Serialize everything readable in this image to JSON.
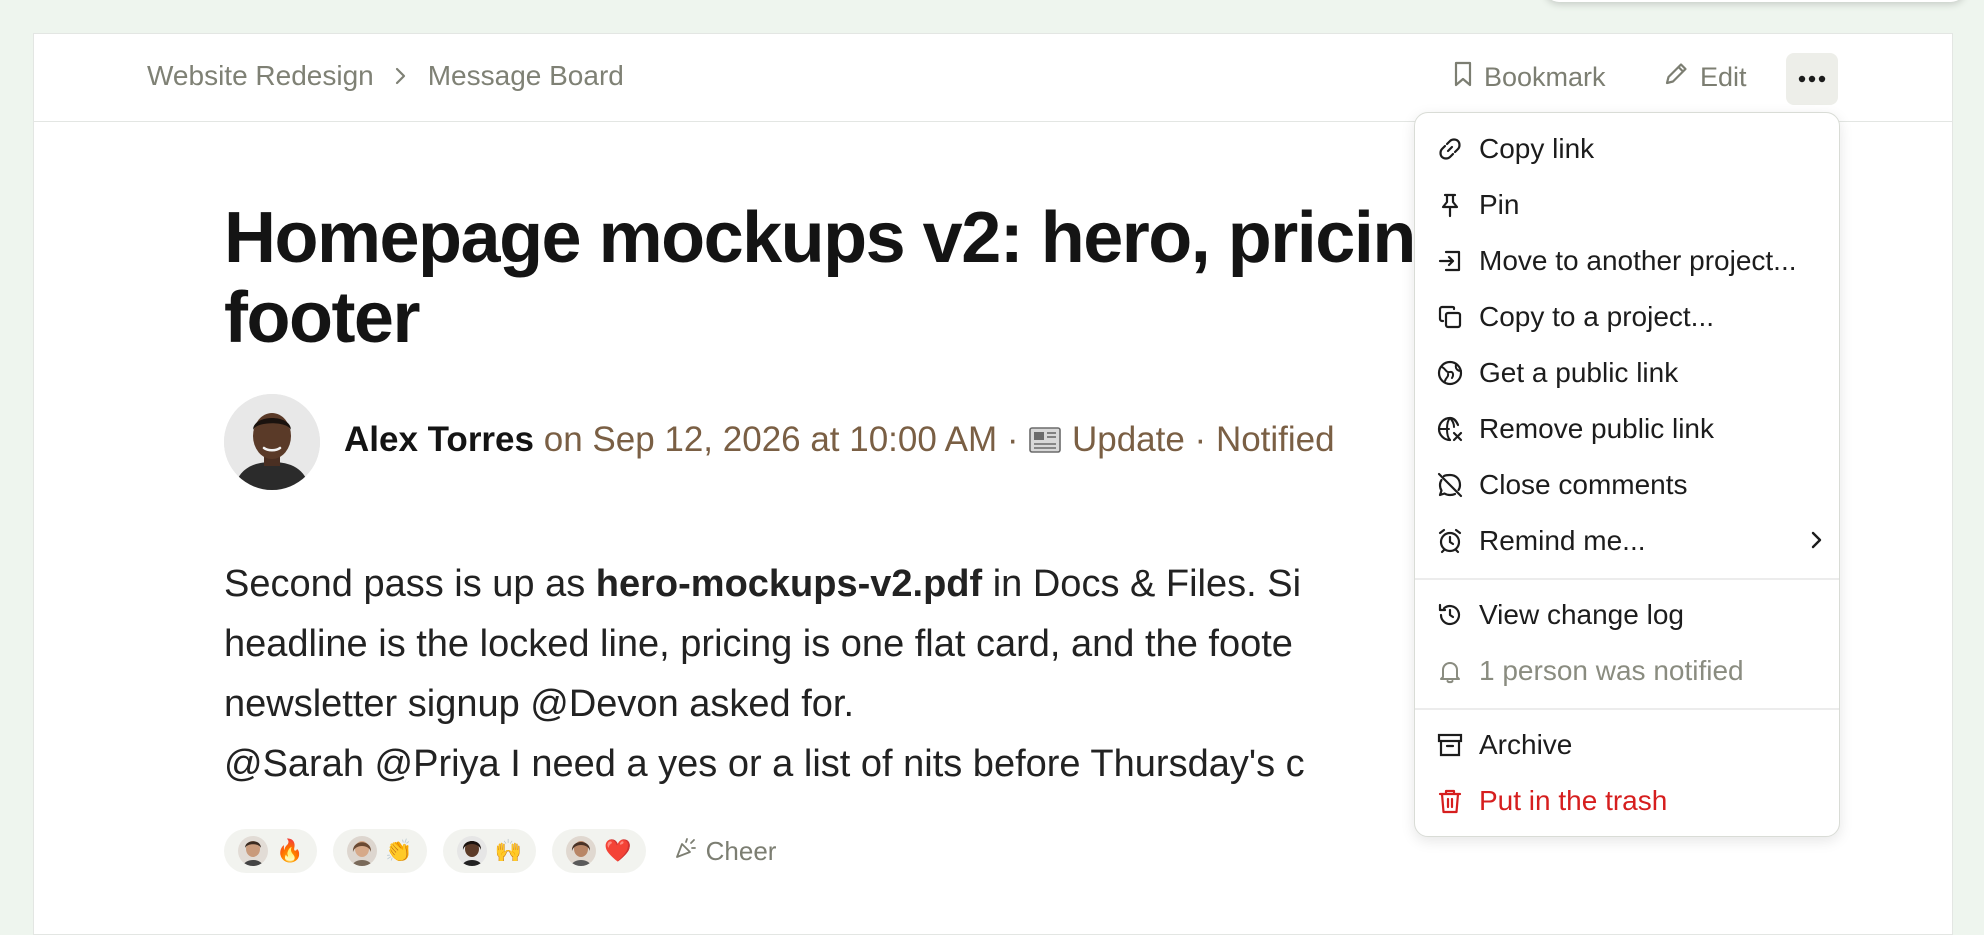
{
  "breadcrumb": {
    "project": "Website Redesign",
    "section": "Message Board"
  },
  "toolbar": {
    "bookmark_label": "Bookmark",
    "edit_label": "Edit"
  },
  "post": {
    "title_line1": "Homepage mockups v2: hero, pricin",
    "title_line2": "footer",
    "author": "Alex Torres",
    "meta_rest": " on Sep 12, 2026 at 10:00 AM · ",
    "meta_tail": " Update · Notified",
    "category_icon": "newspaper-icon",
    "body": {
      "line1_pre": "Second pass is up as ",
      "line1_bold": "hero-mockups-v2.pdf",
      "line1_post": " in Docs & Files. Si",
      "line2": "headline is the locked line, pricing is one flat card, and the foote",
      "line3": "newsletter signup @Devon asked for.",
      "line4": "@Sarah @Priya I need a yes or a list of nits before Thursday's c"
    }
  },
  "reactions": [
    {
      "emoji": "🔥"
    },
    {
      "emoji": "👏"
    },
    {
      "emoji": "🙌"
    },
    {
      "emoji": "❤️"
    }
  ],
  "cheer_label": "Cheer",
  "menu": {
    "copy_link": "Copy link",
    "pin": "Pin",
    "move": "Move to another project...",
    "copy_to": "Copy to a project...",
    "get_public": "Get a public link",
    "remove_public": "Remove public link",
    "close_comments": "Close comments",
    "remind": "Remind me...",
    "change_log": "View change log",
    "notified": "1 person was notified",
    "archive": "Archive",
    "trash": "Put in the trash"
  },
  "colors": {
    "danger": "#d61e1e",
    "meta": "#7a5f44",
    "muted": "#7c7e72"
  }
}
